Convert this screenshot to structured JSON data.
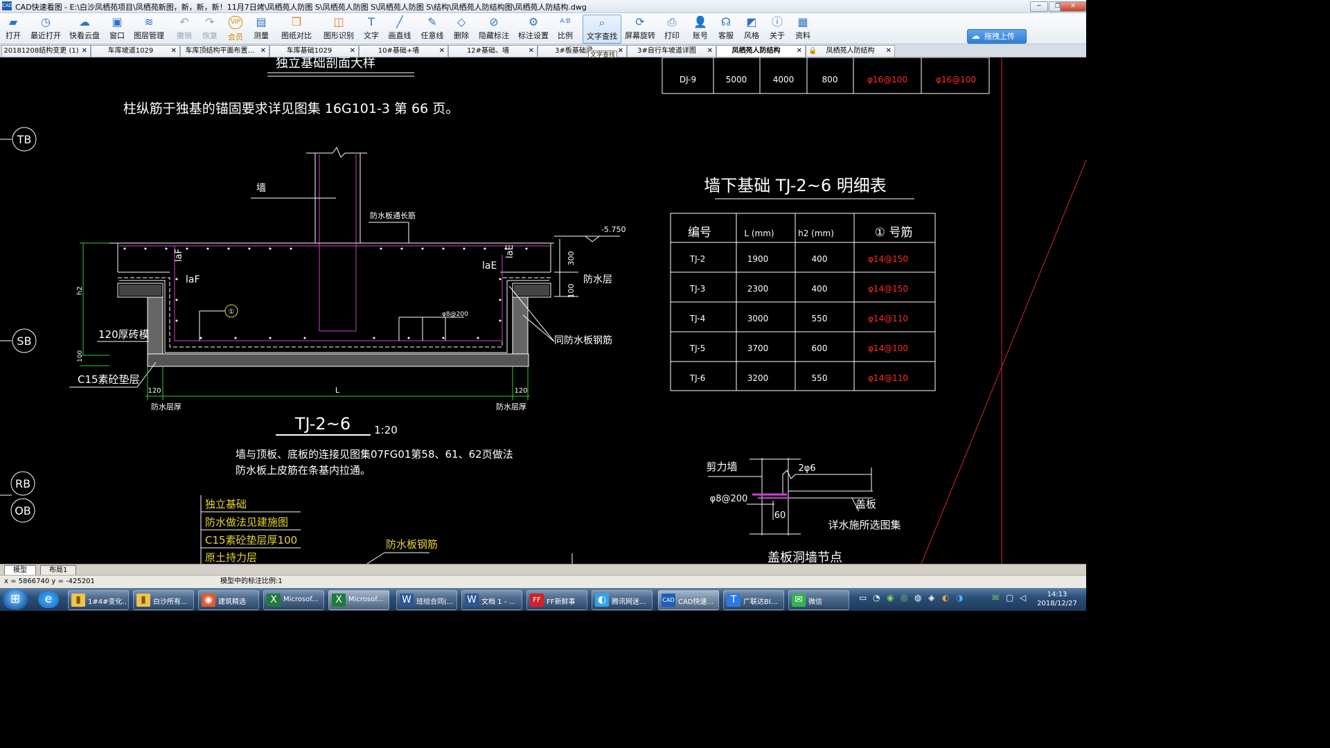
{
  "window": {
    "title": "CAD快速看图 - E:\\白沙凤栖苑项目\\凤栖苑新图，新，新，新！11月7日烤\\凤栖苑人防图 S\\凤栖苑人防图 S\\凤栖苑人防图 S\\结构\\凤栖苑人防结构图\\凤栖苑人防结构.dwg",
    "app_icon": "CAD",
    "minimize": "─",
    "restore": "❐",
    "close": "✕"
  },
  "toolbar": {
    "open": {
      "label": "打开",
      "icon": "folder-open-icon"
    },
    "recent": {
      "label": "最近打开",
      "icon": "clock-icon"
    },
    "cloud": {
      "label": "快看云盘",
      "icon": "cloud-icon"
    },
    "window": {
      "label": "窗口",
      "icon": "window-icon"
    },
    "layers": {
      "label": "图层管理",
      "icon": "layers-icon"
    },
    "undo": {
      "label": "撤销",
      "icon": "undo-icon"
    },
    "redo": {
      "label": "恢复",
      "icon": "redo-icon"
    },
    "vip": {
      "label": "会员",
      "icon": "vip-icon",
      "icon_text": "VIP"
    },
    "measure": {
      "label": "测量",
      "icon": "ruler-icon"
    },
    "compare": {
      "label": "图纸对比",
      "icon": "compare-icon"
    },
    "recognize": {
      "label": "图形识别",
      "icon": "shape-recognize-icon"
    },
    "text": {
      "label": "文字",
      "icon": "text-icon"
    },
    "line": {
      "label": "画直线",
      "icon": "line-icon"
    },
    "freeline": {
      "label": "任意线",
      "icon": "pen-icon"
    },
    "delete": {
      "label": "删除",
      "icon": "eraser-icon"
    },
    "hide": {
      "label": "隐藏标注",
      "icon": "hide-eye-icon"
    },
    "dimset": {
      "label": "标注设置",
      "icon": "settings-icon"
    },
    "scale": {
      "label": "比例",
      "icon": "scale-icon",
      "icon_text": "A:B"
    },
    "textsearch": {
      "label": "文字查找",
      "icon": "text-search-icon"
    },
    "rotate": {
      "label": "屏幕旋转",
      "icon": "rotate-icon"
    },
    "print": {
      "label": "打印",
      "icon": "printer-icon"
    },
    "account": {
      "label": "账号",
      "icon": "user-icon"
    },
    "service": {
      "label": "客服",
      "icon": "headset-icon"
    },
    "style": {
      "label": "风格",
      "icon": "style-icon"
    },
    "about": {
      "label": "关于",
      "icon": "info-icon"
    },
    "resources": {
      "label": "资料",
      "icon": "docs-icon"
    },
    "upload": {
      "label": "拖拽上传",
      "icon": "cloud-upload-icon"
    }
  },
  "tabs": [
    {
      "label": "20181208结构变更 (1)",
      "close": "✕"
    },
    {
      "label": "车库坡道1029",
      "close": "✕"
    },
    {
      "label": "车库顶结构平面布置…",
      "close": "✕"
    },
    {
      "label": "车库基础1029",
      "close": "✕"
    },
    {
      "label": "10#基础+墙",
      "close": "✕"
    },
    {
      "label": "12#基础、墙",
      "close": "✕"
    },
    {
      "label": "3#板基础梁…",
      "close": "✕"
    },
    {
      "label": "3#自行车坡道详图",
      "close": "✕"
    },
    {
      "label": "凤栖苑人防结构",
      "close": "✕"
    },
    {
      "label": "凤栖苑人防结构",
      "close": "✕"
    }
  ],
  "tooltip": "文字查找",
  "drawing": {
    "top_title": "独立基础剖面大样",
    "note_anchor": "柱纵筋于独基的锚固要求详见图集 16G101-3 第 66 页。",
    "axis_tb": "TB",
    "axis_sb": "SB",
    "axis_rb": "RB",
    "axis_ob": "OB",
    "label_wall": "墙",
    "label_top_long": "防水板通长筋",
    "elev": "-5.750",
    "d300": "300",
    "d100": "100",
    "laf": "laF",
    "laf2": "laF",
    "lae": "laE",
    "lae2": "laE",
    "label_waterproof": "防水层",
    "h2": "h2",
    "brick": "120厚砖模",
    "d100b": "100",
    "c15": "C15素砼垫层",
    "rebar_spec": "φ8@200",
    "circle1": "①",
    "same_rebar": "同防水板钢筋",
    "dim_120l": "120",
    "dim_l": "L",
    "dim_120r": "120",
    "wp_layer_l": "防水层厚",
    "wp_layer_r": "防水层厚",
    "detail_title": "TJ-2~6",
    "detail_scale": "1:20",
    "note_conn1": "墙与顶板、底板的连接见图集07FG01第58、61、62页做法",
    "note_conn2": "防水板上皮筋在条基内拉通。",
    "legend_1": "独立基础",
    "legend_2": "防水做法见建施图",
    "legend_3": "C15素砼垫层厚100",
    "legend_4": "原土持力层",
    "label_wp_rebar": "防水板钢筋",
    "table_dj": {
      "code": "DJ-9",
      "a": "5000",
      "b": "4000",
      "h": "800",
      "r1": "φ16@100",
      "r2": "φ16@100"
    },
    "table_title": "墙下基础 TJ-2~6 明细表",
    "table_headers": [
      "编号",
      "L (mm)",
      "h2 (mm)",
      "① 号筋"
    ],
    "table_rows": [
      {
        "code": "TJ-2",
        "l": "1900",
        "h2": "400",
        "bar": "φ14@150"
      },
      {
        "code": "TJ-3",
        "l": "2300",
        "h2": "400",
        "bar": "φ14@150"
      },
      {
        "code": "TJ-4",
        "l": "3000",
        "h2": "550",
        "bar": "φ14@110"
      },
      {
        "code": "TJ-5",
        "l": "3700",
        "h2": "600",
        "bar": "φ14@100"
      },
      {
        "code": "TJ-6",
        "l": "3200",
        "h2": "550",
        "bar": "φ14@110"
      }
    ],
    "shear_wall": "剪力墙",
    "bar_2_6": "2φ6",
    "phi8": "φ8@200",
    "dim60": "60",
    "cover_plate": "盖板",
    "detail_ref": "详水施所选图集",
    "bottom_title": "盖板洞墙节点"
  },
  "layout_tabs": {
    "model": "模型",
    "layout1": "布局1"
  },
  "status": {
    "coords": "x = 5866740  y = -425201",
    "scale_text": "模型中的标注比例:1"
  },
  "taskbar": {
    "start_icon": "windows-start-icon",
    "items": [
      {
        "label": "1#4#变化...",
        "icon": "folder-icon"
      },
      {
        "label": "白沙所有...",
        "icon": "folder-icon"
      },
      {
        "label": "建筑精选",
        "icon": "browser-icon"
      },
      {
        "label": "Microsof...",
        "icon": "excel-icon"
      },
      {
        "label": "Microsof...",
        "icon": "excel-icon"
      },
      {
        "label": "班组合同(...",
        "icon": "word-icon"
      },
      {
        "label": "文档 1 - ...",
        "icon": "word-icon"
      },
      {
        "label": "FF新鲜事",
        "icon": "ff-icon"
      },
      {
        "label": "腾讯网迷...",
        "icon": "qq-browser-icon"
      },
      {
        "label": "CAD快速...",
        "icon": "cad-icon"
      },
      {
        "label": "广联达BI...",
        "icon": "t-icon"
      },
      {
        "label": "微信",
        "icon": "wechat-icon"
      }
    ],
    "clock_time": "14:13",
    "clock_date": "2018/12/27"
  }
}
